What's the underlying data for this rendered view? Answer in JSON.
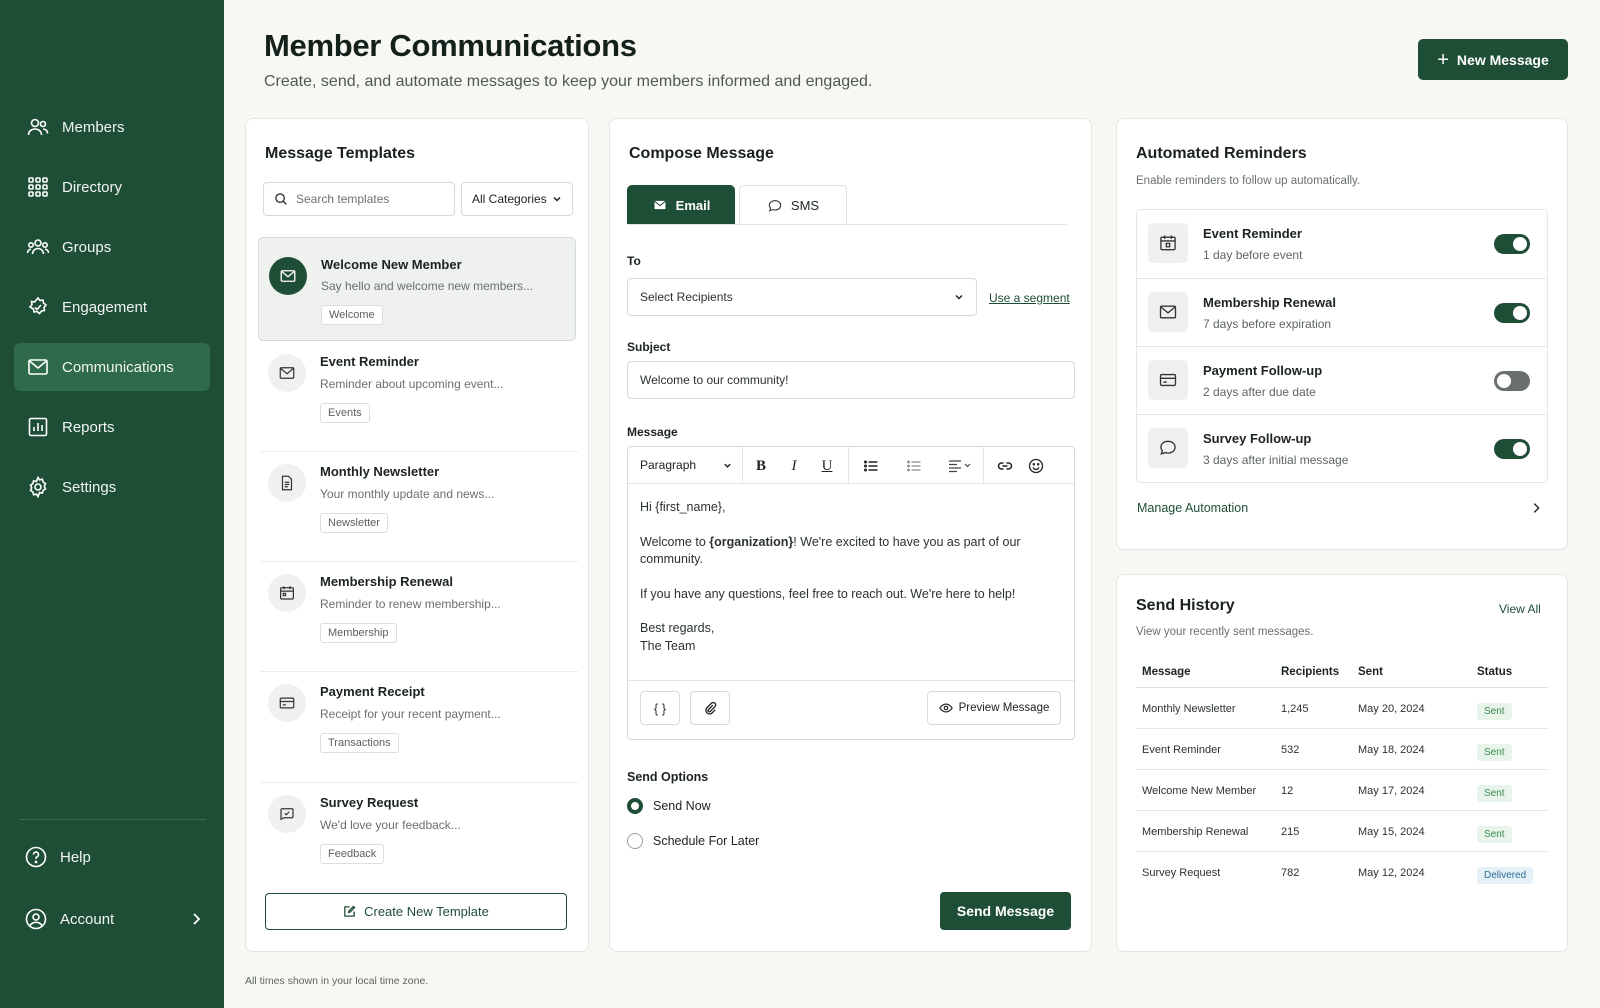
{
  "sidebar": {
    "items": [
      {
        "label": "Members",
        "icon": "users-icon"
      },
      {
        "label": "Directory",
        "icon": "grid-icon"
      },
      {
        "label": "Groups",
        "icon": "group-icon"
      },
      {
        "label": "Engagement",
        "icon": "engagement-icon"
      },
      {
        "label": "Communications",
        "icon": "mail-icon",
        "active": true
      },
      {
        "label": "Reports",
        "icon": "chart-icon"
      },
      {
        "label": "Settings",
        "icon": "gear-icon"
      }
    ],
    "help": "Help",
    "account": "Account"
  },
  "header": {
    "title": "Member Communications",
    "subtitle": "Create, send, and automate messages to keep your members informed and engaged.",
    "new_message": "New Message"
  },
  "templates": {
    "title": "Message Templates",
    "search_placeholder": "Search templates",
    "category": "All Categories",
    "items": [
      {
        "name": "Welcome New Member",
        "desc": "Say hello and welcome new members...",
        "tag": "Welcome",
        "icon": "mail-icon"
      },
      {
        "name": "Event Reminder",
        "desc": "Reminder about upcoming event...",
        "tag": "Events",
        "icon": "mail-icon"
      },
      {
        "name": "Monthly Newsletter",
        "desc": "Your monthly update and news...",
        "tag": "Newsletter",
        "icon": "document-icon"
      },
      {
        "name": "Membership Renewal",
        "desc": "Reminder to renew membership...",
        "tag": "Membership",
        "icon": "calendar-icon"
      },
      {
        "name": "Payment Receipt",
        "desc": "Receipt for your recent payment...",
        "tag": "Transactions",
        "icon": "card-icon"
      },
      {
        "name": "Survey Request",
        "desc": "We'd love your feedback...",
        "tag": "Feedback",
        "icon": "survey-icon"
      }
    ],
    "create": "Create New Template"
  },
  "compose": {
    "title": "Compose Message",
    "tabs": {
      "email": "Email",
      "sms": "SMS"
    },
    "to_label": "To",
    "recipients": "Select Recipients",
    "segment_link": "Use a segment",
    "subject_label": "Subject",
    "subject_value": "Welcome to our community!",
    "message_label": "Message",
    "toolbar": {
      "paragraph": "Paragraph",
      "bold": "B",
      "italic": "I",
      "underline": "U"
    },
    "body": {
      "greeting": "Hi {first_name},",
      "line1_pre": "Welcome to ",
      "line1_bold": "{organization}",
      "line1_post": "! We're excited to have you as part of our community.",
      "line2": "If you have any questions, feel free to reach out. We're here to help!",
      "sign1": "Best regards,",
      "sign2": "The Team"
    },
    "variables_button": "{ }",
    "preview": "Preview Message",
    "send_options_label": "Send Options",
    "send_now": "Send Now",
    "schedule": "Schedule For Later",
    "send_button": "Send Message"
  },
  "reminders": {
    "title": "Automated Reminders",
    "subtitle": "Enable reminders to follow up automatically.",
    "items": [
      {
        "name": "Event Reminder",
        "sub": "1 day before event",
        "on": true,
        "icon": "calendar-icon"
      },
      {
        "name": "Membership Renewal",
        "sub": "7 days before expiration",
        "on": true,
        "icon": "mail-icon"
      },
      {
        "name": "Payment Follow-up",
        "sub": "2 days after due date",
        "on": false,
        "icon": "card-icon"
      },
      {
        "name": "Survey Follow-up",
        "sub": "3 days after initial message",
        "on": true,
        "icon": "chat-icon"
      }
    ],
    "manage": "Manage Automation"
  },
  "history": {
    "title": "Send History",
    "subtitle": "View your recently sent messages.",
    "view_all": "View All",
    "columns": [
      "Message",
      "Recipients",
      "Sent",
      "Status"
    ],
    "rows": [
      {
        "message": "Monthly Newsletter",
        "recipients": "1,245",
        "sent": "May 20, 2024",
        "status": "Sent"
      },
      {
        "message": "Event Reminder",
        "recipients": "532",
        "sent": "May 18, 2024",
        "status": "Sent"
      },
      {
        "message": "Welcome New Member",
        "recipients": "12",
        "sent": "May 17, 2024",
        "status": "Sent"
      },
      {
        "message": "Membership Renewal",
        "recipients": "215",
        "sent": "May 15, 2024",
        "status": "Sent"
      },
      {
        "message": "Survey Request",
        "recipients": "782",
        "sent": "May 12, 2024",
        "status": "Delivered"
      }
    ]
  },
  "footer": "All times shown in your local time zone.",
  "colors": {
    "brand": "#1f4e36",
    "sent": "#3b8a54",
    "delivered": "#2c6f95"
  }
}
